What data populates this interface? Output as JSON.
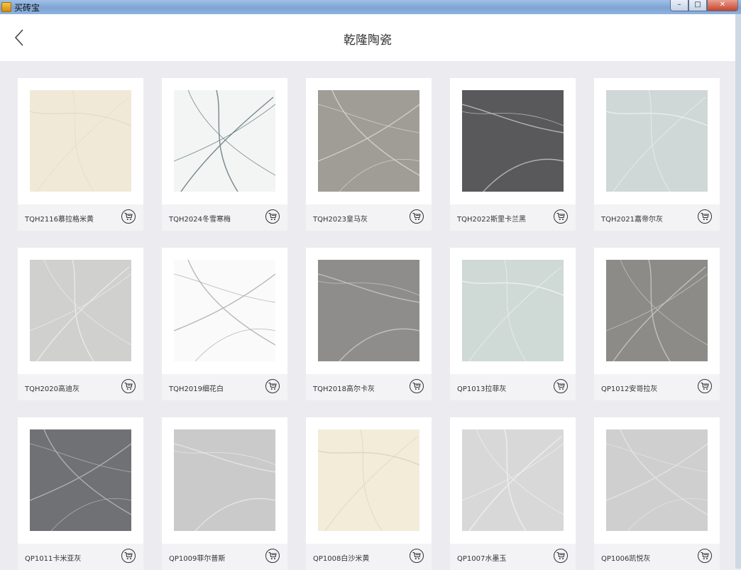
{
  "window": {
    "title": "买砖宝"
  },
  "header": {
    "title": "乾隆陶瓷"
  },
  "products": [
    {
      "name": "TQH2116慕拉格米黄",
      "swatch": "#f1e9d8",
      "vein": "#e4d8c1"
    },
    {
      "name": "TQH2024冬雪寒梅",
      "swatch": "#f3f4f4",
      "vein": "#5d7578"
    },
    {
      "name": "TQH2023皇马灰",
      "swatch": "#a09d97",
      "vein": "#d9d7d3"
    },
    {
      "name": "TQH2022斯里卡兰黑",
      "swatch": "#59595b",
      "vein": "#c4c4c6"
    },
    {
      "name": "TQH2021嘉帝尔灰",
      "swatch": "#cfd8d7",
      "vein": "#eef2f1"
    },
    {
      "name": "TQH2020高迪灰",
      "swatch": "#d0d0cf",
      "vein": "#ededec"
    },
    {
      "name": "TQH2019细花白",
      "swatch": "#fafafa",
      "vein": "#a9adae"
    },
    {
      "name": "TQH2018高尔卡灰",
      "swatch": "#8e8d8b",
      "vein": "#c9c8c6"
    },
    {
      "name": "QP1013拉菲灰",
      "swatch": "#cfd9d6",
      "vein": "#f0f4f3"
    },
    {
      "name": "QP1012安哥拉灰",
      "swatch": "#8d8b88",
      "vein": "#cbc9c6"
    },
    {
      "name": "QP1011卡米亚灰",
      "swatch": "#707174",
      "vein": "#b7b8bb"
    },
    {
      "name": "QP1009菲尔普斯",
      "swatch": "#cacaca",
      "vein": "#e9e9e9"
    },
    {
      "name": "QP1008白沙米黄",
      "swatch": "#f3ecd9",
      "vein": "#ddd1b6"
    },
    {
      "name": "QP1007水墨玉",
      "swatch": "#d8d8d9",
      "vein": "#f2f2f2"
    },
    {
      "name": "QP1006凯悦灰",
      "swatch": "#cfcfcf",
      "vein": "#e6e6e6"
    }
  ]
}
